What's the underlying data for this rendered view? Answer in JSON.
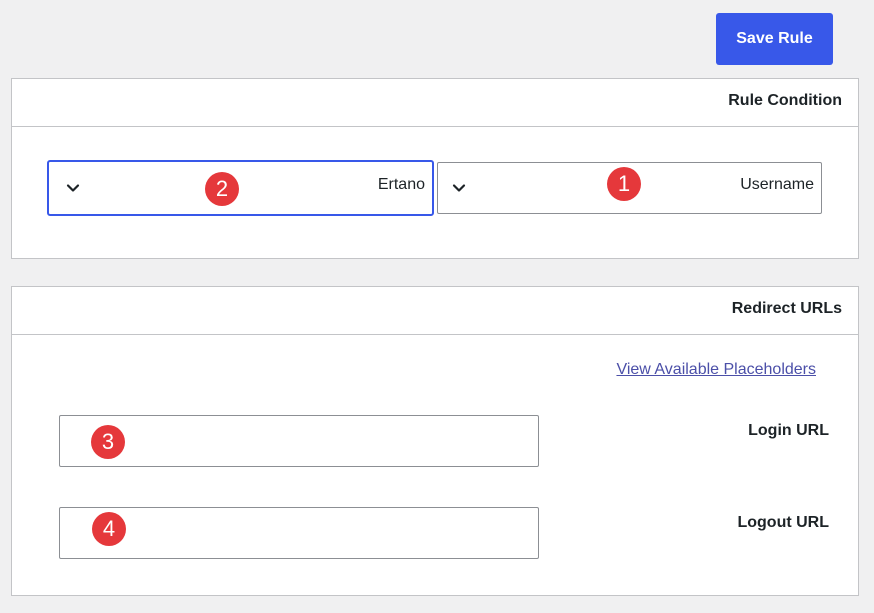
{
  "toolbar": {
    "save_label": "Save Rule"
  },
  "rule_condition": {
    "title": "Rule Condition",
    "field_select": {
      "value": "Username",
      "badge": "1"
    },
    "value_select": {
      "value": "Ertano",
      "badge": "2"
    }
  },
  "redirect_urls": {
    "title": "Redirect URLs",
    "placeholders_link": "View Available Placeholders",
    "login": {
      "label": "Login URL",
      "value": "",
      "badge": "3"
    },
    "logout": {
      "label": "Logout URL",
      "value": "",
      "badge": "4"
    }
  },
  "colors": {
    "accent": "#3858e9",
    "badge": "#e5383b",
    "link": "#4b4fa8",
    "background": "#f0f0f1"
  }
}
